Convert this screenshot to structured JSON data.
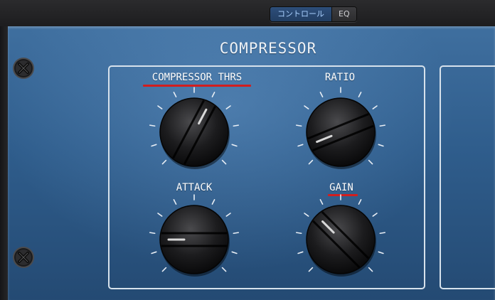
{
  "toolbar": {
    "tabs": [
      {
        "label": "コントロール",
        "active": true
      },
      {
        "label": "EQ",
        "active": false
      }
    ]
  },
  "plugin": {
    "title": "COMPRESSOR",
    "knobs": [
      {
        "label": "COMPRESSOR THRS",
        "underlined": true
      },
      {
        "label": "RATIO",
        "underlined": false
      },
      {
        "label": "ATTACK",
        "underlined": false
      },
      {
        "label": "GAIN",
        "underlined": true
      }
    ]
  },
  "colors": {
    "panel_blue": "#2f5d8c",
    "highlight_underline": "#d21e1e",
    "active_tab": "#2d4e7a"
  },
  "icons": [
    "screw-icon",
    "screw-icon"
  ]
}
